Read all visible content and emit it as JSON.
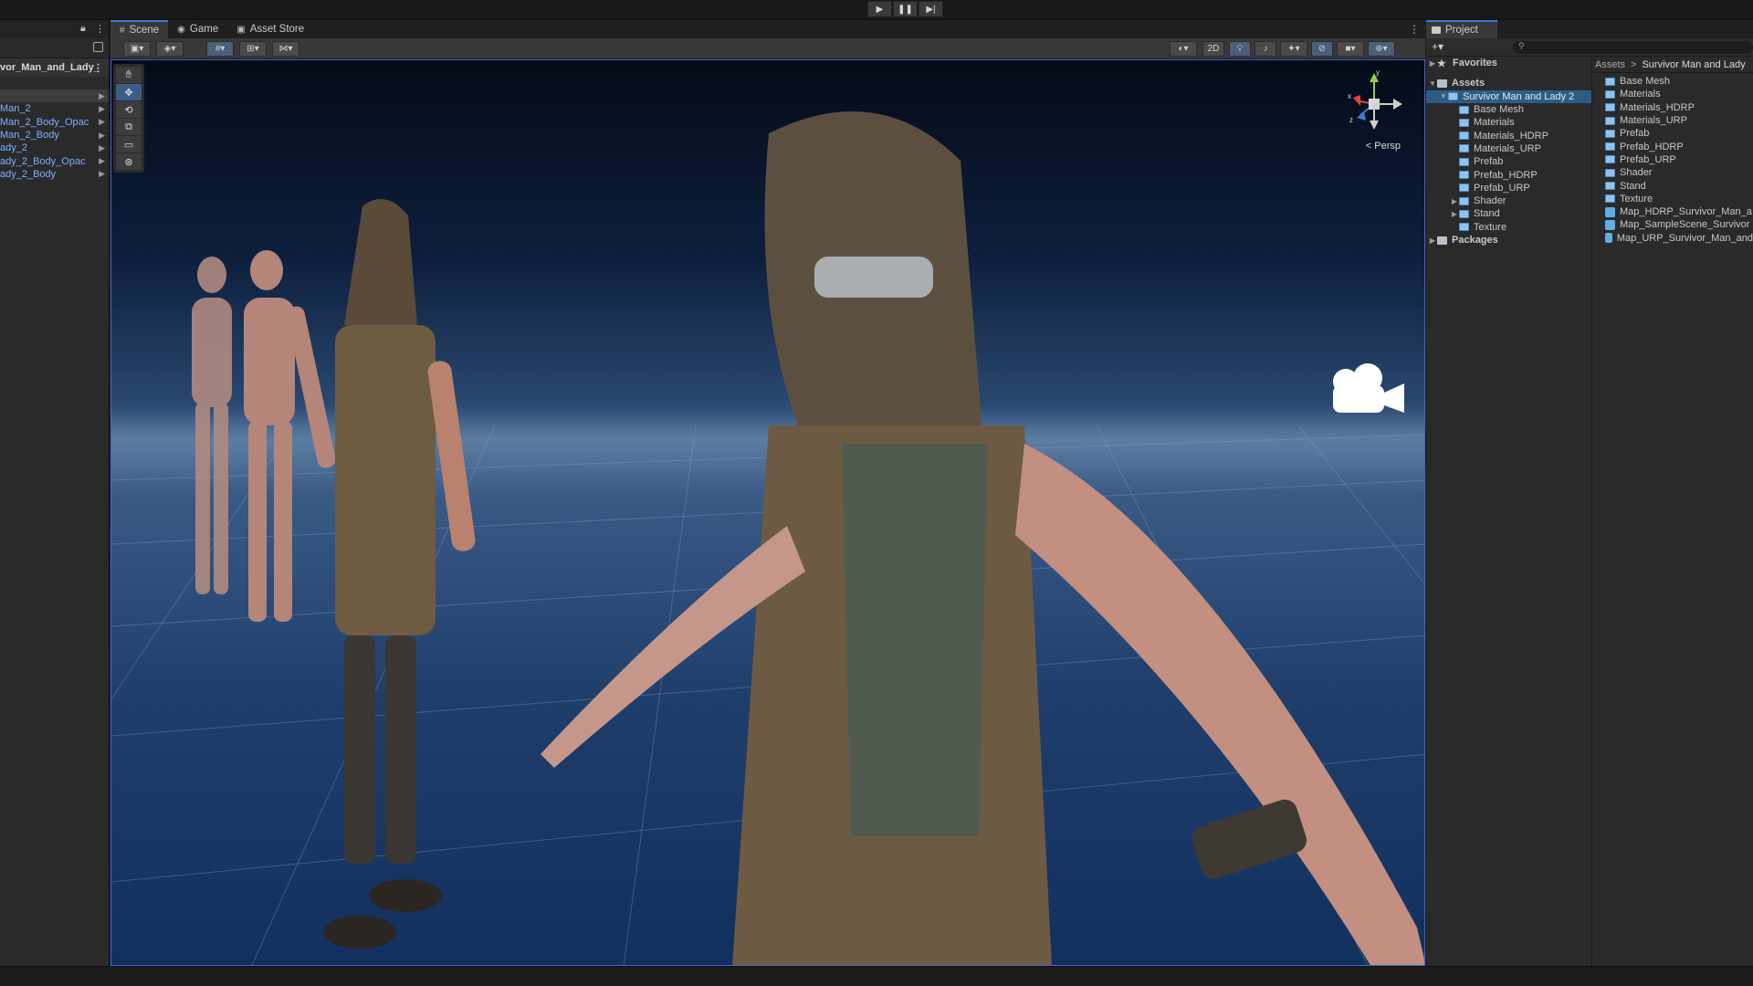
{
  "toolbar": {
    "play": "▶",
    "pause": "❚❚",
    "step": "▶|"
  },
  "hierarchy": {
    "scene_name": "vor_Man_and_Lady_",
    "items": [
      {
        "label": "",
        "selected": true
      },
      {
        "label": "Man_2"
      },
      {
        "label": "Man_2_Body_Opac"
      },
      {
        "label": "Man_2_Body"
      },
      {
        "label": "ady_2"
      },
      {
        "label": "ady_2_Body_Opac"
      },
      {
        "label": "ady_2_Body"
      }
    ]
  },
  "scene": {
    "tabs": [
      {
        "label": "Scene",
        "icon": "grid-icon",
        "active": true
      },
      {
        "label": "Game",
        "icon": "gamepad-icon"
      },
      {
        "label": "Asset Store",
        "icon": "bag-icon"
      }
    ],
    "toolbar": {
      "mode_2d": "2D"
    },
    "persp_label": "< Persp",
    "gizmo": {
      "x": "x",
      "y": "y",
      "z": "z"
    }
  },
  "project": {
    "tab_label": "Project",
    "add_label": "+▾",
    "search_placeholder": "",
    "tree": {
      "favorites": "Favorites",
      "assets": "Assets",
      "selected_folder": "Survivor Man and Lady 2",
      "subfolders": [
        "Base Mesh",
        "Materials",
        "Materials_HDRP",
        "Materials_URP",
        "Prefab",
        "Prefab_HDRP",
        "Prefab_URP",
        "Shader",
        "Stand",
        "Texture"
      ],
      "packages": "Packages"
    },
    "breadcrumb": {
      "root": "Assets",
      "sep": ">",
      "current": "Survivor Man and Lady"
    },
    "contents": [
      {
        "label": "Base Mesh",
        "type": "folder"
      },
      {
        "label": "Materials",
        "type": "folder"
      },
      {
        "label": "Materials_HDRP",
        "type": "folder"
      },
      {
        "label": "Materials_URP",
        "type": "folder"
      },
      {
        "label": "Prefab",
        "type": "folder"
      },
      {
        "label": "Prefab_HDRP",
        "type": "folder"
      },
      {
        "label": "Prefab_URP",
        "type": "folder"
      },
      {
        "label": "Shader",
        "type": "folder"
      },
      {
        "label": "Stand",
        "type": "folder"
      },
      {
        "label": "Texture",
        "type": "folder"
      },
      {
        "label": "Map_HDRP_Survivor_Man_a",
        "type": "scene"
      },
      {
        "label": "Map_SampleScene_Survivor",
        "type": "scene"
      },
      {
        "label": "Map_URP_Survivor_Man_and",
        "type": "scene"
      }
    ]
  },
  "colors": {
    "accent": "#3a79d9",
    "selection": "#2c5d87",
    "link": "#7fb1ff"
  }
}
